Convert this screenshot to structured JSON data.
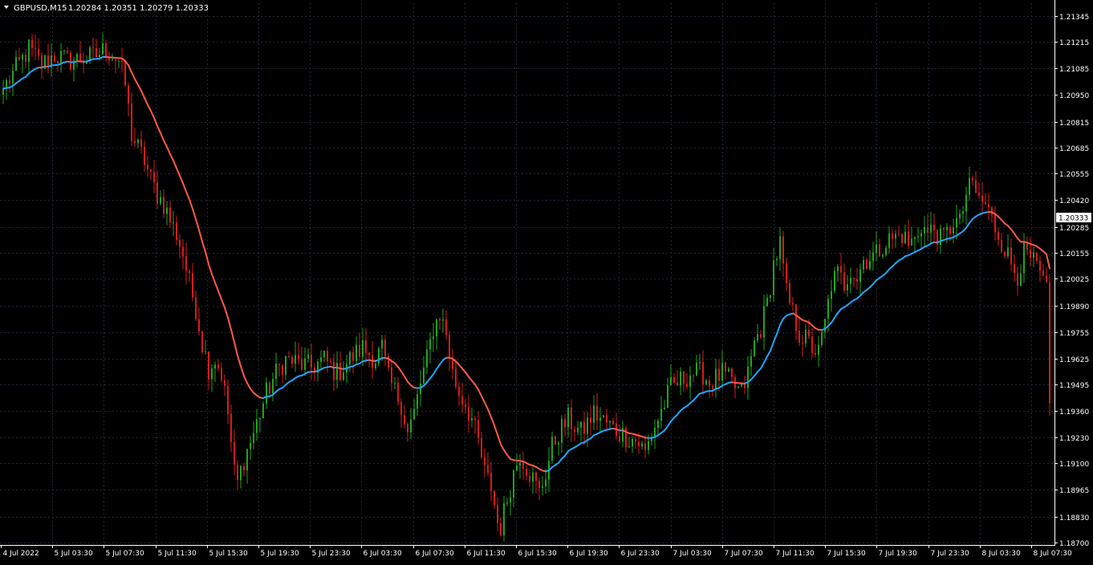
{
  "header": {
    "symbol_label": "GBPUSD,M15",
    "ohlc_text": "1.20284 1.20351 1.20279 1.20333"
  },
  "colors": {
    "background": "#000000",
    "axis": "#ffffff",
    "grid": "#1c2a3a",
    "bull": "#1ea51e",
    "bear": "#d61b1b",
    "ma_up": "#1ea7ff",
    "ma_down": "#ff5a45",
    "price_tag_bg": "#ffffff",
    "price_tag_text": "#000000"
  },
  "chart_data": {
    "type": "candlestick",
    "title": "",
    "xlabel": "",
    "ylabel": "",
    "ylim": [
      1.187,
      1.2141
    ],
    "grid": true,
    "current_price": "1.20333",
    "y_ticks": [
      "1.21345",
      "1.21215",
      "1.21085",
      "1.20950",
      "1.20815",
      "1.20685",
      "1.20555",
      "1.20420",
      "1.20285",
      "1.20155",
      "1.20025",
      "1.19890",
      "1.19755",
      "1.19625",
      "1.19495",
      "1.19360",
      "1.19230",
      "1.19100",
      "1.18965",
      "1.18830",
      "1.18700"
    ],
    "x_ticks": [
      "4 Jul 2022",
      "5 Jul 03:30",
      "5 Jul 07:30",
      "5 Jul 11:30",
      "5 Jul 15:30",
      "5 Jul 19:30",
      "5 Jul 23:30",
      "6 Jul 03:30",
      "6 Jul 07:30",
      "6 Jul 11:30",
      "6 Jul 15:30",
      "6 Jul 19:30",
      "6 Jul 23:30",
      "7 Jul 03:30",
      "7 Jul 07:30",
      "7 Jul 11:30",
      "7 Jul 15:30",
      "7 Jul 19:30",
      "7 Jul 23:30",
      "8 Jul 03:30",
      "8 Jul 07:30"
    ],
    "price_path": [
      [
        0,
        1.2098
      ],
      [
        4,
        1.2108
      ],
      [
        8,
        1.2118
      ],
      [
        12,
        1.211
      ],
      [
        16,
        1.2115
      ],
      [
        20,
        1.2112
      ],
      [
        24,
        1.2113
      ],
      [
        28,
        1.2114
      ],
      [
        32,
        1.2118
      ],
      [
        36,
        1.2112
      ],
      [
        38,
        1.21
      ],
      [
        40,
        1.2075
      ],
      [
        42,
        1.2068
      ],
      [
        44,
        1.2062
      ],
      [
        46,
        1.2052
      ],
      [
        48,
        1.2045
      ],
      [
        50,
        1.204
      ],
      [
        52,
        1.2032
      ],
      [
        54,
        1.2025
      ],
      [
        56,
        1.2015
      ],
      [
        58,
        1.2
      ],
      [
        60,
        1.1988
      ],
      [
        62,
        1.197
      ],
      [
        64,
        1.1958
      ],
      [
        66,
        1.1962
      ],
      [
        68,
        1.1955
      ],
      [
        70,
        1.1935
      ],
      [
        71,
        1.192
      ],
      [
        72,
        1.1905
      ],
      [
        73,
        1.19
      ],
      [
        75,
        1.1912
      ],
      [
        78,
        1.1925
      ],
      [
        80,
        1.1935
      ],
      [
        82,
        1.1945
      ],
      [
        84,
        1.1952
      ],
      [
        86,
        1.1958
      ],
      [
        88,
        1.1962
      ],
      [
        92,
        1.196
      ],
      [
        96,
        1.1958
      ],
      [
        100,
        1.1962
      ],
      [
        104,
        1.1955
      ],
      [
        108,
        1.1962
      ],
      [
        112,
        1.1968
      ],
      [
        116,
        1.1962
      ],
      [
        118,
        1.1968
      ],
      [
        120,
        1.1952
      ],
      [
        124,
        1.194
      ],
      [
        126,
        1.1925
      ],
      [
        128,
        1.1935
      ],
      [
        130,
        1.195
      ],
      [
        132,
        1.1962
      ],
      [
        134,
        1.1978
      ],
      [
        136,
        1.1985
      ],
      [
        138,
        1.1975
      ],
      [
        140,
        1.1955
      ],
      [
        142,
        1.1945
      ],
      [
        144,
        1.194
      ],
      [
        146,
        1.1932
      ],
      [
        148,
        1.192
      ],
      [
        150,
        1.1905
      ],
      [
        152,
        1.1898
      ],
      [
        154,
        1.188
      ],
      [
        155,
        1.1878
      ],
      [
        157,
        1.1892
      ],
      [
        159,
        1.1905
      ],
      [
        161,
        1.1915
      ],
      [
        163,
        1.1908
      ],
      [
        165,
        1.1902
      ],
      [
        167,
        1.1895
      ],
      [
        169,
        1.1905
      ],
      [
        171,
        1.1918
      ],
      [
        173,
        1.1925
      ],
      [
        176,
        1.1932
      ],
      [
        180,
        1.1925
      ],
      [
        184,
        1.1935
      ],
      [
        188,
        1.193
      ],
      [
        192,
        1.1925
      ],
      [
        196,
        1.1922
      ],
      [
        198,
        1.192
      ],
      [
        200,
        1.1915
      ],
      [
        202,
        1.1925
      ],
      [
        204,
        1.1932
      ],
      [
        206,
        1.194
      ],
      [
        208,
        1.1948
      ],
      [
        210,
        1.195
      ],
      [
        214,
        1.1955
      ],
      [
        218,
        1.1955
      ],
      [
        220,
        1.195
      ],
      [
        224,
        1.1955
      ],
      [
        228,
        1.1948
      ],
      [
        230,
        1.1945
      ],
      [
        232,
        1.1955
      ],
      [
        234,
        1.197
      ],
      [
        236,
        1.1978
      ],
      [
        238,
        1.199
      ],
      [
        240,
        1.201
      ],
      [
        242,
        1.202
      ],
      [
        244,
        1.1995
      ],
      [
        246,
        1.1985
      ],
      [
        248,
        1.1975
      ],
      [
        250,
        1.1972
      ],
      [
        252,
        1.1968
      ],
      [
        254,
        1.1965
      ],
      [
        256,
        1.198
      ],
      [
        258,
        1.2
      ],
      [
        260,
        1.2005
      ],
      [
        262,
        1.2
      ],
      [
        264,
        1.2008
      ],
      [
        266,
        1.2003
      ],
      [
        268,
        1.2012
      ],
      [
        272,
        1.2015
      ],
      [
        274,
        1.202
      ],
      [
        276,
        1.2022
      ],
      [
        280,
        1.2025
      ],
      [
        282,
        1.202
      ],
      [
        284,
        1.2022
      ],
      [
        286,
        1.203
      ],
      [
        288,
        1.2025
      ],
      [
        290,
        1.2028
      ],
      [
        292,
        1.2022
      ],
      [
        294,
        1.2025
      ],
      [
        296,
        1.2032
      ],
      [
        298,
        1.203
      ],
      [
        300,
        1.2045
      ],
      [
        302,
        1.205
      ],
      [
        304,
        1.2042
      ],
      [
        306,
        1.204
      ],
      [
        308,
        1.2032
      ],
      [
        310,
        1.2025
      ],
      [
        312,
        1.2018
      ],
      [
        314,
        1.201
      ],
      [
        316,
        1.2005
      ],
      [
        318,
        1.2015
      ],
      [
        320,
        1.2012
      ],
      [
        322,
        1.2008
      ],
      [
        324,
        1.2
      ],
      [
        325,
        1.1995
      ],
      [
        326,
        1.194
      ]
    ]
  }
}
